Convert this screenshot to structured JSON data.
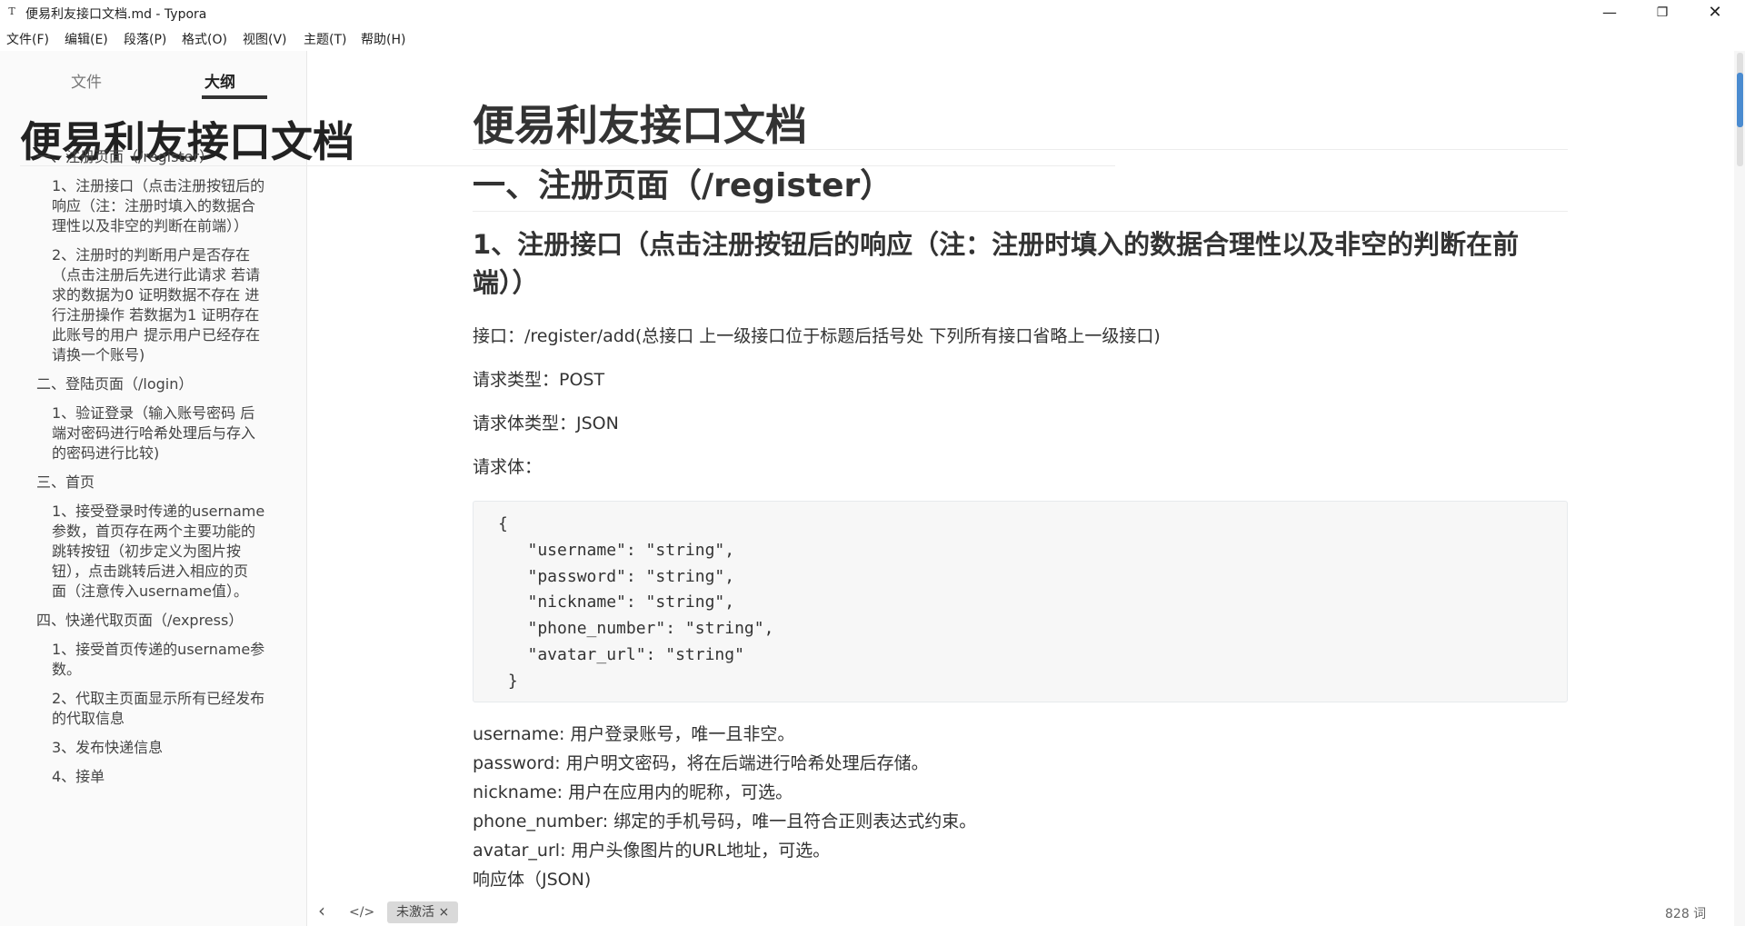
{
  "window": {
    "app_icon": "T",
    "title": "便易利友接口文档.md - Typora",
    "minimize_glyph": "—",
    "maximize_glyph": "❐",
    "close_glyph": "✕"
  },
  "menu": [
    "文件(F)",
    "编辑(E)",
    "段落(P)",
    "格式(O)",
    "视图(V)",
    "主题(T)",
    "帮助(H)"
  ],
  "sidebar": {
    "tabs": [
      {
        "label": "文件",
        "active": false
      },
      {
        "label": "大纲",
        "active": true
      }
    ],
    "outline": [
      {
        "level": 1,
        "text": "便易利友接口文档"
      },
      {
        "level": 2,
        "text": "一、注册页面（/register）"
      },
      {
        "level": 3,
        "lines": [
          "1、注册接口（点击注册按钮后的",
          "响应（注：注册时填入的数据合",
          "理性以及非空的判断在前端））"
        ]
      },
      {
        "level": 3,
        "lines": [
          "2、注册时的判断用户是否存在",
          "（点击注册后先进行此请求 若请",
          "求的数据为0 证明数据不存在 进",
          "行注册操作 若数据为1 证明存在",
          "此账号的用户 提示用户已经存在",
          "请换一个账号)"
        ]
      },
      {
        "level": 2,
        "text": "二、登陆页面（/login）"
      },
      {
        "level": 3,
        "lines": [
          "1、验证登录（输入账号密码 后",
          "端对密码进行哈希处理后与存入",
          "的密码进行比较)"
        ]
      },
      {
        "level": 2,
        "text": "三、首页"
      },
      {
        "level": 3,
        "lines": [
          "1、接受登录时传递的username",
          "参数，首页存在两个主要功能的",
          "跳转按钮（初步定义为图片按",
          "钮），点击跳转后进入相应的页",
          "面（注意传入username值）。"
        ]
      },
      {
        "level": 2,
        "text": "四、快递代取页面（/express）"
      },
      {
        "level": 3,
        "lines": [
          "1、接受首页传递的username参",
          "数。"
        ]
      },
      {
        "level": 3,
        "lines": [
          "2、代取主页面显示所有已经发布",
          "的代取信息"
        ]
      },
      {
        "level": 3,
        "text": "3、发布快递信息"
      },
      {
        "level": 3,
        "text": "4、接单"
      }
    ]
  },
  "doc": {
    "h1": "便易利友接口文档",
    "h2": "一、注册页面（/register）",
    "h3_lines": [
      "1、注册接口（点击注册按钮后的响应（注：注册时填入的数据合理性以及非空的判断在前",
      "端））"
    ],
    "api_line": "接口：/register/add(总接口 上一级接口位于标题后括号处 下列所有接口省略上一级接口)",
    "method_line": "请求类型：POST",
    "body_type_line": "请求体类型：JSON",
    "body_label": "请求体：",
    "code": [
      "{",
      "   \"username\": \"string\",",
      "   \"password\": \"string\",",
      "   \"nickname\": \"string\",",
      "   \"phone_number\": \"string\",",
      "   \"avatar_url\": \"string\"",
      " }"
    ],
    "fields": [
      "username: 用户登录账号，唯一且非空。",
      "password: 用户明文密码，将在后端进行哈希处理后存储。",
      "nickname: 用户在应用内的昵称，可选。",
      "phone_number: 绑定的手机号码，唯一且符合正则表达式约束。",
      "avatar_url: 用户头像图片的URL地址，可选。"
    ],
    "response_label": "响应体（JSON)",
    "code2_first": "{"
  },
  "status": {
    "back_glyph": "‹",
    "source_glyph": "</>",
    "badge": "未激活 ×",
    "word_count": "828 词"
  },
  "colors": {
    "accent": "#4a8bd0",
    "sidebar_bg": "#fafafa",
    "code_bg": "#f7f7f7"
  }
}
